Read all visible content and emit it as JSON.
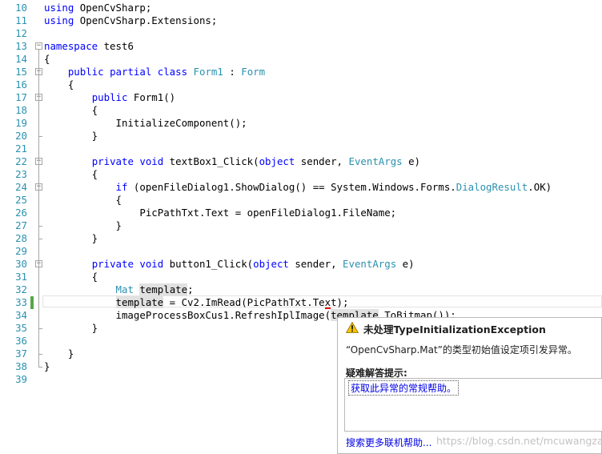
{
  "editor": {
    "lines": [
      {
        "no": "10",
        "tokens": [
          [
            "kw",
            "using"
          ],
          [
            "p",
            " OpenCvSharp;"
          ]
        ]
      },
      {
        "no": "11",
        "tokens": [
          [
            "kw",
            "using"
          ],
          [
            "p",
            " OpenCvSharp.Extensions;"
          ]
        ]
      },
      {
        "no": "12",
        "tokens": []
      },
      {
        "no": "13",
        "tokens": [
          [
            "kw",
            "namespace"
          ],
          [
            "p",
            " test6"
          ]
        ]
      },
      {
        "no": "14",
        "tokens": [
          [
            "p",
            "{"
          ]
        ]
      },
      {
        "no": "15",
        "tokens": [
          [
            "p",
            "    "
          ],
          [
            "kw",
            "public"
          ],
          [
            "p",
            " "
          ],
          [
            "kw",
            "partial"
          ],
          [
            "p",
            " "
          ],
          [
            "kw",
            "class"
          ],
          [
            "p",
            " "
          ],
          [
            "ty",
            "Form1"
          ],
          [
            "p",
            " : "
          ],
          [
            "ty",
            "Form"
          ]
        ]
      },
      {
        "no": "16",
        "tokens": [
          [
            "p",
            "    {"
          ]
        ]
      },
      {
        "no": "17",
        "tokens": [
          [
            "p",
            "        "
          ],
          [
            "kw",
            "public"
          ],
          [
            "p",
            " Form1()"
          ]
        ]
      },
      {
        "no": "18",
        "tokens": [
          [
            "p",
            "        {"
          ]
        ]
      },
      {
        "no": "19",
        "tokens": [
          [
            "p",
            "            InitializeComponent();"
          ]
        ]
      },
      {
        "no": "20",
        "tokens": [
          [
            "p",
            "        }"
          ]
        ]
      },
      {
        "no": "21",
        "tokens": []
      },
      {
        "no": "22",
        "tokens": [
          [
            "p",
            "        "
          ],
          [
            "kw",
            "private"
          ],
          [
            "p",
            " "
          ],
          [
            "kw",
            "void"
          ],
          [
            "p",
            " textBox1_Click("
          ],
          [
            "kw",
            "object"
          ],
          [
            "p",
            " sender, "
          ],
          [
            "ty",
            "EventArgs"
          ],
          [
            "p",
            " e)"
          ]
        ]
      },
      {
        "no": "23",
        "tokens": [
          [
            "p",
            "        {"
          ]
        ]
      },
      {
        "no": "24",
        "tokens": [
          [
            "p",
            "            "
          ],
          [
            "kw",
            "if"
          ],
          [
            "p",
            " (openFileDialog1.ShowDialog() == System.Windows.Forms."
          ],
          [
            "ty",
            "DialogResult"
          ],
          [
            "p",
            ".OK)"
          ]
        ]
      },
      {
        "no": "25",
        "tokens": [
          [
            "p",
            "            {"
          ]
        ]
      },
      {
        "no": "26",
        "tokens": [
          [
            "p",
            "                PicPathTxt.Text = openFileDialog1.FileName;"
          ]
        ]
      },
      {
        "no": "27",
        "tokens": [
          [
            "p",
            "            }"
          ]
        ]
      },
      {
        "no": "28",
        "tokens": [
          [
            "p",
            "        }"
          ]
        ]
      },
      {
        "no": "29",
        "tokens": []
      },
      {
        "no": "30",
        "tokens": [
          [
            "p",
            "        "
          ],
          [
            "kw",
            "private"
          ],
          [
            "p",
            " "
          ],
          [
            "kw",
            "void"
          ],
          [
            "p",
            " button1_Click("
          ],
          [
            "kw",
            "object"
          ],
          [
            "p",
            " sender, "
          ],
          [
            "ty",
            "EventArgs"
          ],
          [
            "p",
            " e)"
          ]
        ]
      },
      {
        "no": "31",
        "tokens": [
          [
            "p",
            "        {"
          ]
        ]
      },
      {
        "no": "32",
        "tokens": [
          [
            "p",
            "            "
          ],
          [
            "ty",
            "Mat"
          ],
          [
            "p",
            " "
          ],
          [
            "hl",
            "template"
          ],
          [
            "p",
            ";"
          ]
        ]
      },
      {
        "no": "33",
        "tokens": [
          [
            "p",
            "            "
          ],
          [
            "hl",
            "template"
          ],
          [
            "p",
            " = Cv2.ImRead(PicPathTxt.Text);"
          ]
        ]
      },
      {
        "no": "34",
        "tokens": [
          [
            "p",
            "            imageProcessBoxCus1.RefreshIplImage("
          ],
          [
            "hl",
            "template"
          ],
          [
            "p",
            ".ToBitmap());"
          ]
        ]
      },
      {
        "no": "35",
        "tokens": [
          [
            "p",
            "        }"
          ]
        ]
      },
      {
        "no": "36",
        "tokens": []
      },
      {
        "no": "37",
        "tokens": [
          [
            "p",
            "    }"
          ]
        ]
      },
      {
        "no": "38",
        "tokens": [
          [
            "p",
            "}"
          ]
        ]
      },
      {
        "no": "39",
        "tokens": []
      }
    ],
    "collapsible_lines": [
      "13",
      "15",
      "17",
      "22",
      "24",
      "30"
    ]
  },
  "popup": {
    "icon": "warning-icon",
    "title": "未处理TypeInitializationException",
    "message": "“OpenCvSharp.Mat”的类型初始值设定项引发异常。",
    "tips_label": "疑难解答提示:",
    "tips_link": "获取此异常的常规帮助。",
    "more_link": "搜索更多联机帮助..."
  },
  "watermark": "https://blog.csdn.net/mcuwangzai",
  "colors": {
    "keyword": "#0000ff",
    "type": "#2b91af",
    "line_number": "#2b91af",
    "change_bar": "#57a64a",
    "link": "#0000e6"
  }
}
